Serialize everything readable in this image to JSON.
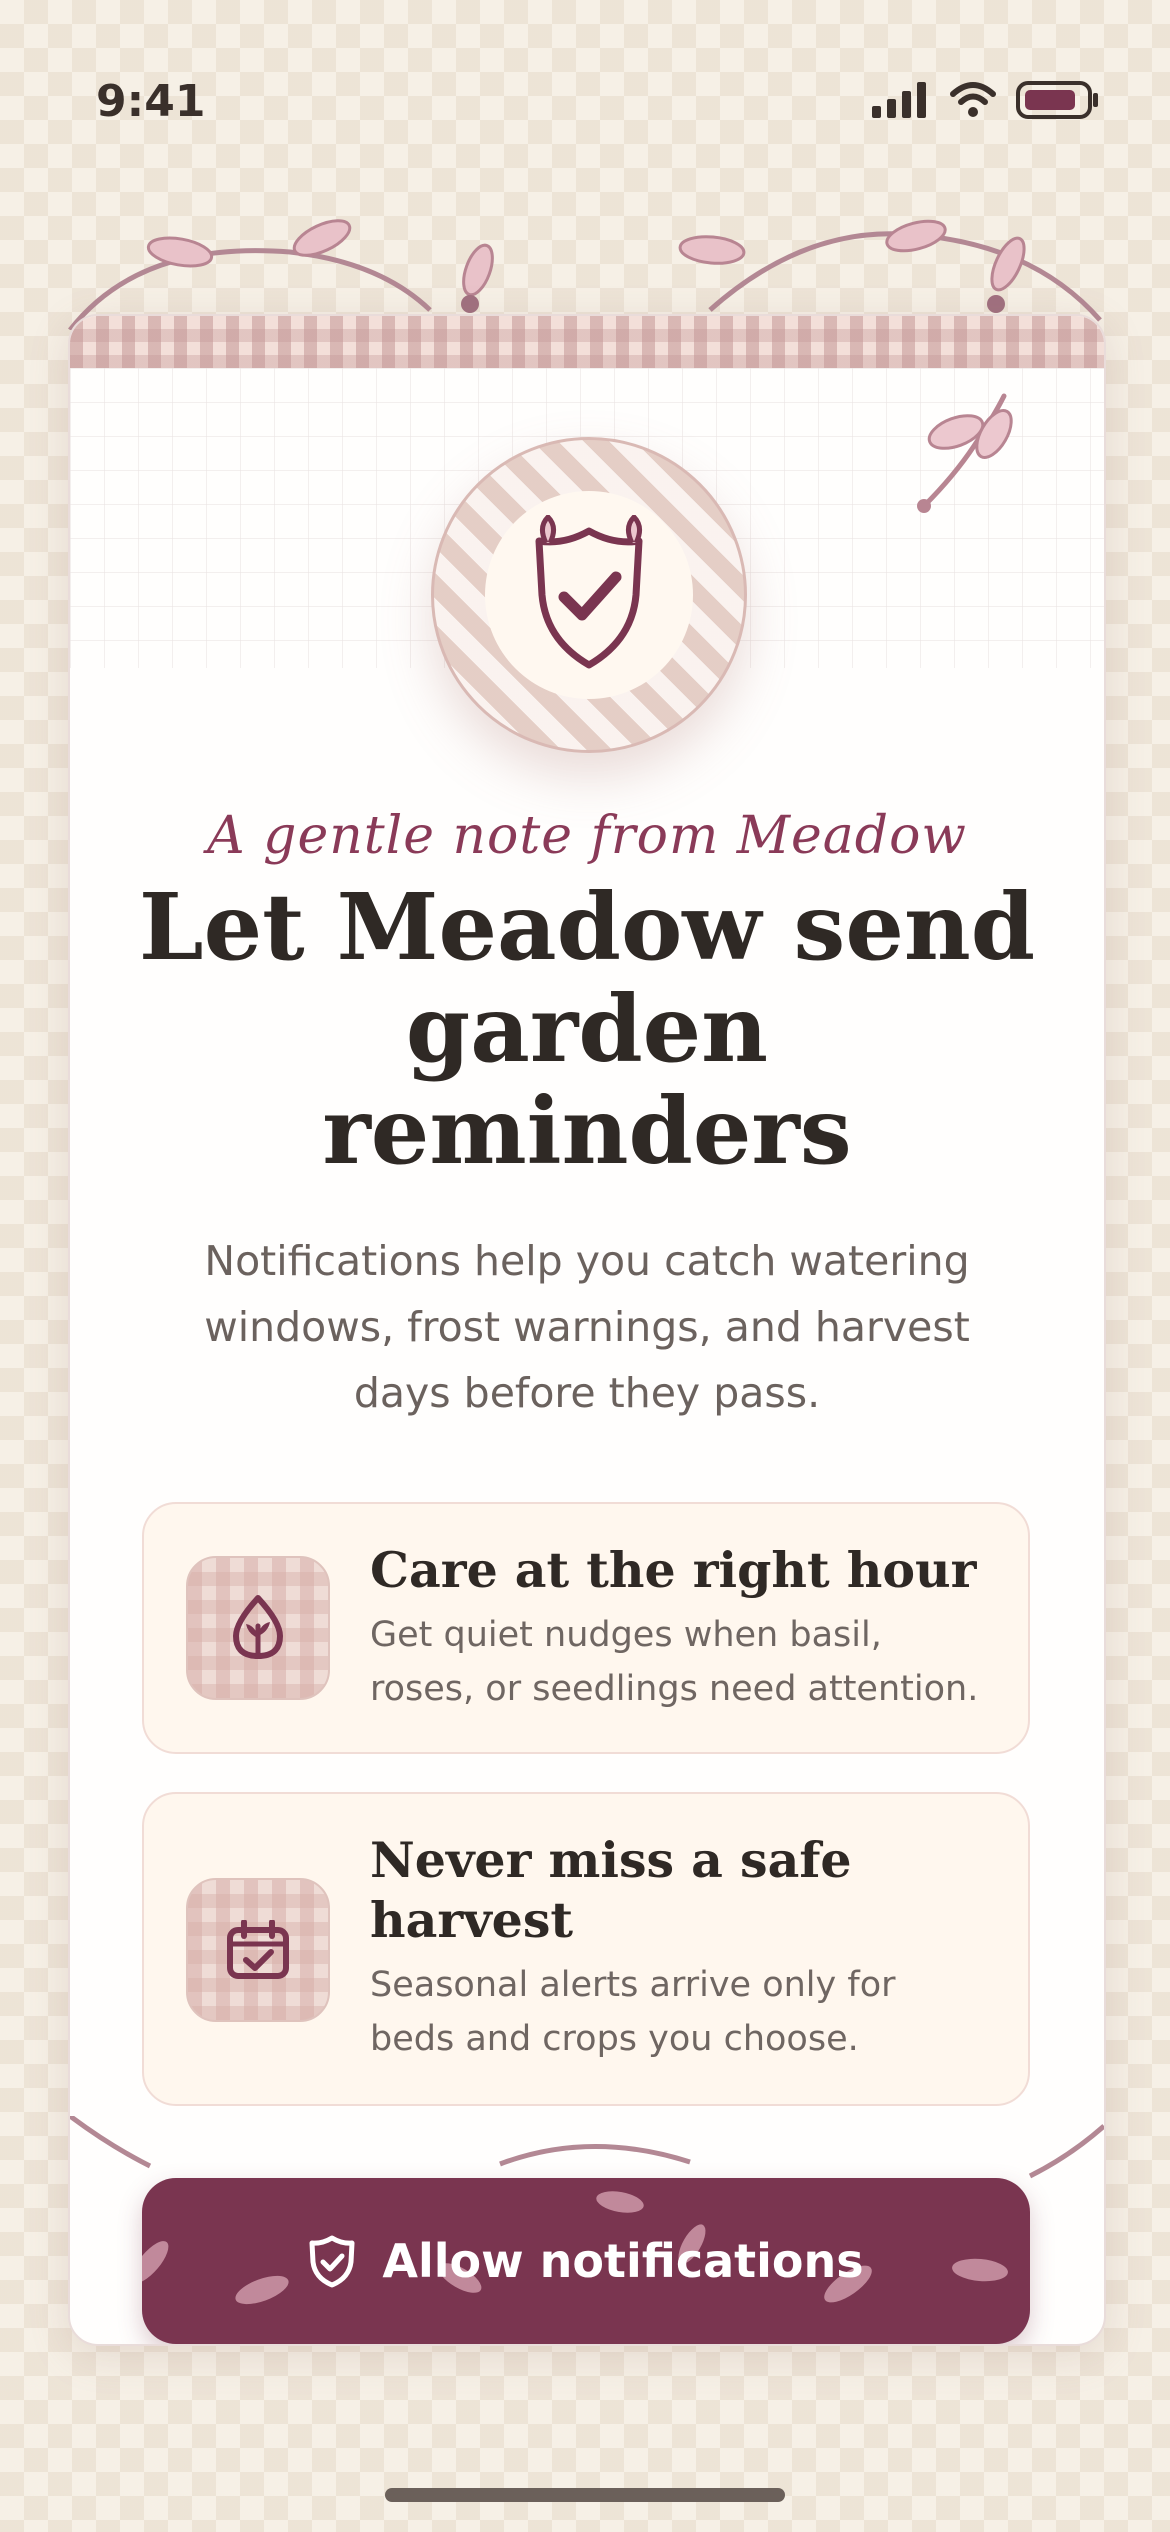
{
  "status_bar": {
    "time": "9:41",
    "icons": [
      "signal-icon",
      "wifi-icon",
      "battery-icon"
    ]
  },
  "badge": {
    "icon": "shield-check-icon"
  },
  "intro": {
    "kicker": "A gentle note from Meadow",
    "title": "Let Meadow send garden reminders",
    "subtitle": "Notifications help you catch watering windows, frost warnings, and harvest days before they pass."
  },
  "features": [
    {
      "icon": "leaf-drop-icon",
      "title": "Care at the right hour",
      "description": "Get quiet nudges when basil, roses, or seedlings need attention."
    },
    {
      "icon": "calendar-check-icon",
      "title": "Never miss a safe harvest",
      "description": "Seasonal alerts arrive only for beds and crops you choose."
    }
  ],
  "cta": {
    "label": "Allow notifications",
    "icon": "shield-check-icon"
  },
  "colors": {
    "accent": "#7a3550",
    "background": "#f6f0e6",
    "card": "#fffefd",
    "feature_bg": "#fff7ee",
    "title_text": "#2f2925",
    "body_text": "#6b625e"
  }
}
